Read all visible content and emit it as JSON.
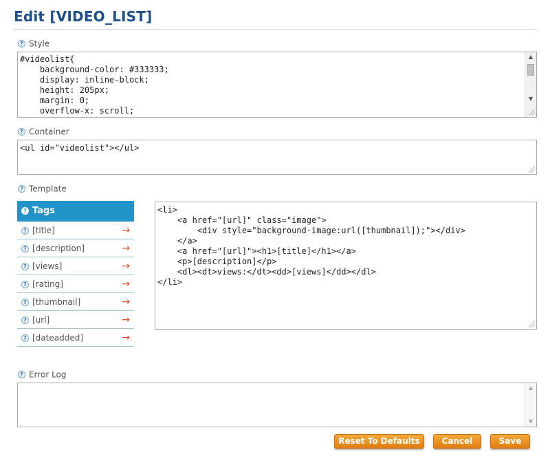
{
  "page": {
    "title": "Edit [VIDEO_LIST]"
  },
  "style": {
    "label": "Style",
    "help": "?",
    "value": "#videolist{\n    background-color: #333333;\n    display: inline-block;\n    height: 205px;\n    margin: 0;\n    overflow-x: scroll;"
  },
  "container": {
    "label": "Container",
    "help": "?",
    "value": "<ul id=\"videolist\"></ul>"
  },
  "template": {
    "label": "Template",
    "help": "?",
    "value": "<li>\n    <a href=\"[url]\" class=\"image\">\n        <div style=\"background-image:url([thumbnail]);\"></div>\n    </a>\n    <a href=\"[url]\"><h1>[title]</h1></a>\n    <p>[description]</p>\n    <dl><dt>views:</dt><dd>[views]</dd></dl>\n</li>"
  },
  "tags": {
    "header": "Tags",
    "help": "?",
    "arrow": "→",
    "items": [
      {
        "label": "[title]"
      },
      {
        "label": "[description]"
      },
      {
        "label": "[views]"
      },
      {
        "label": "[rating]"
      },
      {
        "label": "[thumbnail]"
      },
      {
        "label": "[url]"
      },
      {
        "label": "[dateadded]"
      }
    ]
  },
  "error_log": {
    "label": "Error Log",
    "help": "?",
    "value": ""
  },
  "buttons": {
    "reset": "Reset To Defaults",
    "cancel": "Cancel",
    "save": "Save"
  },
  "colors": {
    "accent": "#2293c9",
    "button": "#f09a27",
    "title": "#1d4f8a",
    "arrow": "#e2452a"
  },
  "icons": {
    "help": "help-circle-icon",
    "tag_arrow": "right-arrow-icon",
    "resize": "resize-grip-icon"
  }
}
